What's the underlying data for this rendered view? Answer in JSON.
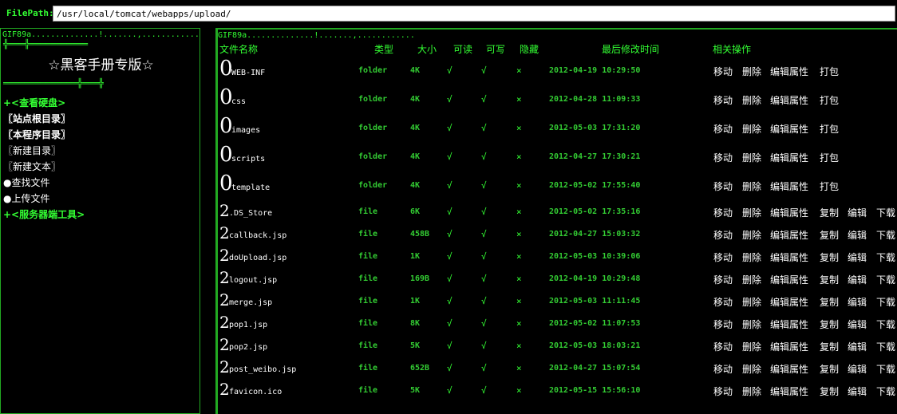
{
  "filepath": {
    "label": "FilePath:",
    "value": "/usr/local/tomcat/webapps/upload/"
  },
  "left_panel": {
    "gif_header": "GIF89a..............!.......,............",
    "deco_top": "╬═══╬═══════════",
    "title": "☆黑客手册专版☆",
    "deco_bottom": "══════════════╬═══╬",
    "items": [
      {
        "label": "+<查看硬盘>",
        "style": "green"
      },
      {
        "label": "〖站点根目录〗",
        "style": "white-bold"
      },
      {
        "label": "〖本程序目录〗",
        "style": "white-bold"
      },
      {
        "label": "〖新建目录〗",
        "style": "white"
      },
      {
        "label": "〖新建文本〗",
        "style": "white"
      },
      {
        "label": "●查找文件",
        "style": "white"
      },
      {
        "label": "●上传文件",
        "style": "white"
      },
      {
        "label": "+<服务器端工具>",
        "style": "green"
      }
    ]
  },
  "file_panel": {
    "gif_header": "GIF89a..............!.......,............",
    "headers": {
      "name": "文件名称",
      "type": "类型",
      "size": "大小",
      "read": "可读",
      "write": "可写",
      "hidden": "隐藏",
      "modified": "最后修改时间",
      "actions": "相关操作"
    },
    "read_flag": "√",
    "write_flag": "√",
    "hidden_flag": "×",
    "folder_actions": [
      "移动",
      "删除",
      "编辑属性",
      "打包"
    ],
    "file_actions": [
      "移动",
      "删除",
      "编辑属性",
      "复制",
      "编辑",
      "下载"
    ],
    "rows": [
      {
        "icon": "0",
        "name": "WEB-INF",
        "type": "folder",
        "size": "4K",
        "time": "2012-04-19 10:29:50"
      },
      {
        "icon": "0",
        "name": "css",
        "type": "folder",
        "size": "4K",
        "time": "2012-04-28 11:09:33"
      },
      {
        "icon": "0",
        "name": "images",
        "type": "folder",
        "size": "4K",
        "time": "2012-05-03 17:31:20"
      },
      {
        "icon": "0",
        "name": "scripts",
        "type": "folder",
        "size": "4K",
        "time": "2012-04-27 17:30:21"
      },
      {
        "icon": "0",
        "name": "template",
        "type": "folder",
        "size": "4K",
        "time": "2012-05-02 17:55:40"
      },
      {
        "icon": "2",
        "name": ".DS_Store",
        "type": "file",
        "size": "6K",
        "time": "2012-05-02 17:35:16"
      },
      {
        "icon": "2",
        "name": "callback.jsp",
        "type": "file",
        "size": "458B",
        "time": "2012-04-27 15:03:32"
      },
      {
        "icon": "2",
        "name": "doUpload.jsp",
        "type": "file",
        "size": "1K",
        "time": "2012-05-03 10:39:06"
      },
      {
        "icon": "2",
        "name": "logout.jsp",
        "type": "file",
        "size": "169B",
        "time": "2012-04-19 10:29:48"
      },
      {
        "icon": "2",
        "name": "merge.jsp",
        "type": "file",
        "size": "1K",
        "time": "2012-05-03 11:11:45"
      },
      {
        "icon": "2",
        "name": "pop1.jsp",
        "type": "file",
        "size": "8K",
        "time": "2012-05-02 11:07:53"
      },
      {
        "icon": "2",
        "name": "pop2.jsp",
        "type": "file",
        "size": "5K",
        "time": "2012-05-03 18:03:21"
      },
      {
        "icon": "2",
        "name": "post_weibo.jsp",
        "type": "file",
        "size": "652B",
        "time": "2012-04-27 15:07:54"
      },
      {
        "icon": "2",
        "name": "favicon.ico",
        "type": "file",
        "size": "5K",
        "time": "2012-05-15 15:56:10"
      }
    ]
  }
}
